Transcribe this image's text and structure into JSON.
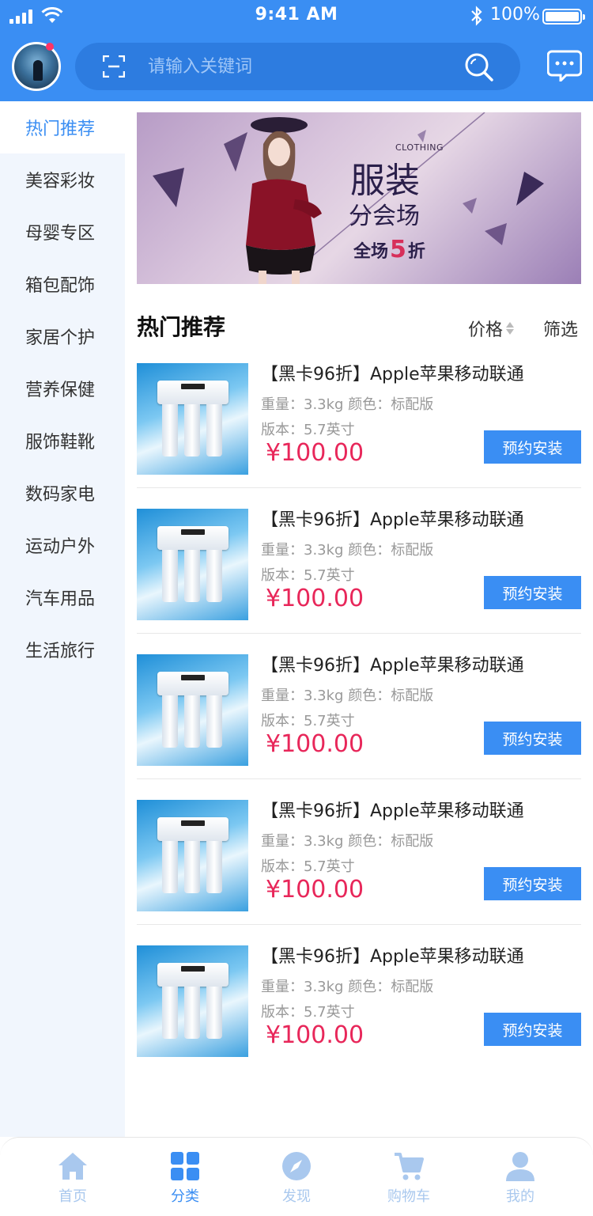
{
  "status_bar": {
    "time": "9:41 AM",
    "battery": "100%"
  },
  "search": {
    "placeholder": "请输入关键词"
  },
  "sidebar": {
    "items": [
      {
        "label": "热门推荐",
        "active": true
      },
      {
        "label": "美容彩妆"
      },
      {
        "label": "母婴专区"
      },
      {
        "label": "箱包配饰"
      },
      {
        "label": "家居个护"
      },
      {
        "label": "营养保健"
      },
      {
        "label": "服饰鞋靴"
      },
      {
        "label": "数码家电"
      },
      {
        "label": "运动户外"
      },
      {
        "label": "汽车用品"
      },
      {
        "label": "生活旅行"
      }
    ]
  },
  "banner": {
    "tag": "CLOTHING",
    "title": "服装",
    "subtitle": "分会场",
    "promo_prefix": "全场",
    "promo_number": "5",
    "promo_suffix": "折"
  },
  "section": {
    "title": "热门推荐",
    "sort_label": "价格",
    "filter_label": "筛选"
  },
  "products": [
    {
      "title": "【黑卡96折】Apple苹果移动联通",
      "spec1": "重量：3.3kg   颜色：标配版",
      "spec2": "版本：5.7英寸",
      "price": "¥100.00",
      "button": "预约安装"
    },
    {
      "title": "【黑卡96折】Apple苹果移动联通",
      "spec1": "重量：3.3kg   颜色：标配版",
      "spec2": "版本：5.7英寸",
      "price": "¥100.00",
      "button": "预约安装"
    },
    {
      "title": "【黑卡96折】Apple苹果移动联通",
      "spec1": "重量：3.3kg   颜色：标配版",
      "spec2": "版本：5.7英寸",
      "price": "¥100.00",
      "button": "预约安装"
    },
    {
      "title": "【黑卡96折】Apple苹果移动联通",
      "spec1": "重量：3.3kg   颜色：标配版",
      "spec2": "版本：5.7英寸",
      "price": "¥100.00",
      "button": "预约安装"
    },
    {
      "title": "【黑卡96折】Apple苹果移动联通",
      "spec1": "重量：3.3kg   颜色：标配版",
      "spec2": "版本：5.7英寸",
      "price": "¥100.00",
      "button": "预约安装"
    }
  ],
  "tabbar": {
    "items": [
      {
        "label": "首页",
        "icon": "home-icon"
      },
      {
        "label": "分类",
        "icon": "grid-icon",
        "active": true
      },
      {
        "label": "发现",
        "icon": "compass-icon"
      },
      {
        "label": "购物车",
        "icon": "cart-icon"
      },
      {
        "label": "我的",
        "icon": "user-icon"
      }
    ]
  },
  "colors": {
    "primary": "#3a8ef3",
    "price": "#e8275a",
    "sidebar_bg": "#f1f6fd",
    "tab_inactive": "#a9c8ee"
  }
}
